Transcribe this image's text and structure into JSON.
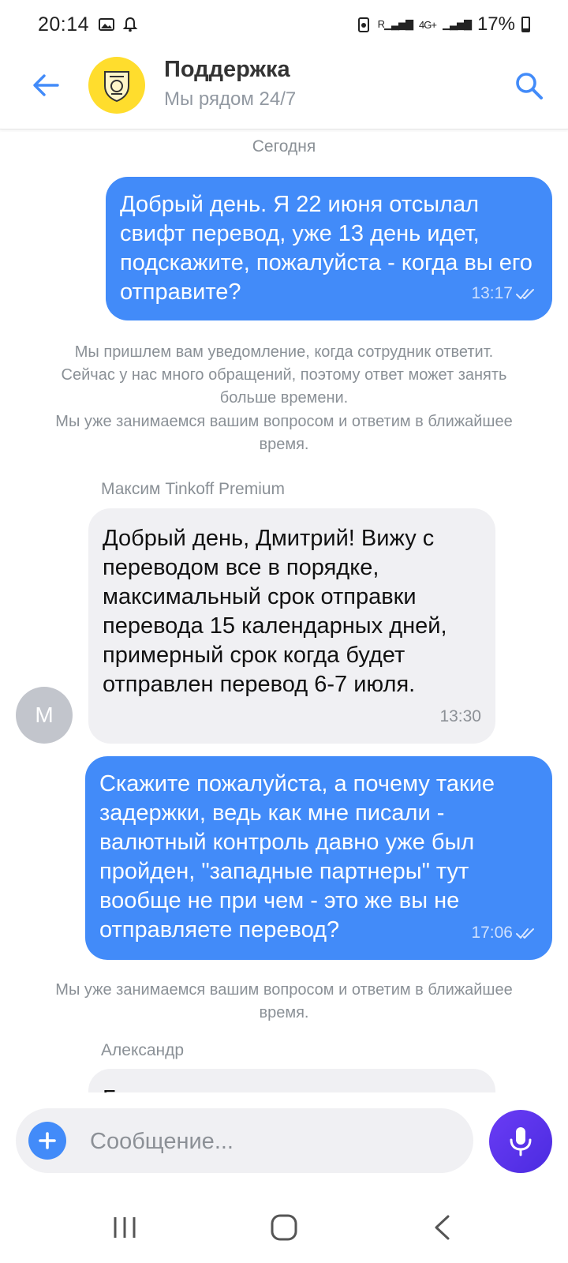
{
  "status_bar": {
    "time": "20:14",
    "battery": "17%",
    "icons": [
      "gallery-icon",
      "notification-bell-icon",
      "battery-saver-icon",
      "signal-icon",
      "4g-icon",
      "signal-icon-2"
    ]
  },
  "header": {
    "title": "Поддержка",
    "subtitle": "Мы рядом 24/7",
    "back_icon": "arrow-left-icon",
    "search_icon": "search-icon",
    "accent_color": "#428bf9"
  },
  "chat": {
    "day_label": "Сегодня",
    "messages": [
      {
        "direction": "out",
        "text": "Добрый день. Я 22 июня отсылал свифт перевод, уже 13 день идет, подскажите, пожалуйста - когда вы его отправите?",
        "time": "13:17",
        "status": "read"
      },
      {
        "type": "system",
        "text": "Мы пришлем вам уведомление, когда сотрудник ответит. Сейчас у нас много обращений, поэтому ответ может занять больше времени."
      },
      {
        "type": "system",
        "text": "Мы уже занимаемся вашим вопросом и ответим в ближайшее время."
      },
      {
        "direction": "in",
        "sender": "Максим Tinkoff Premium",
        "avatar_letter": "М",
        "text": "Добрый день, Дмитрий! Вижу с переводом все в порядке, максимальный срок отправки перевода 15 календарных дней, примерный срок когда будет отправлен перевод 6-7 июля.",
        "time": "13:30"
      },
      {
        "direction": "out",
        "text": "Скажите пожалуйста, а почему такие задержки, ведь как мне писали - валютный контроль давно уже был пройден, \"западные партнеры\" тут вообще не при чем - это же вы не отправляете перевод?",
        "time": "17:06",
        "status": "read"
      },
      {
        "type": "system",
        "text": "Мы уже занимаемся вашим вопросом и ответим в ближайшее время."
      },
      {
        "direction": "in",
        "sender": "Александр",
        "text": "Банк-корреспондент принимает"
      }
    ]
  },
  "composer": {
    "placeholder": "Сообщение...",
    "plus_icon": "plus-icon",
    "mic_icon": "microphone-icon",
    "mic_color": "#5b33ea"
  },
  "nav_bar": {
    "icons": [
      "recent-apps-icon",
      "home-icon",
      "back-icon"
    ]
  }
}
